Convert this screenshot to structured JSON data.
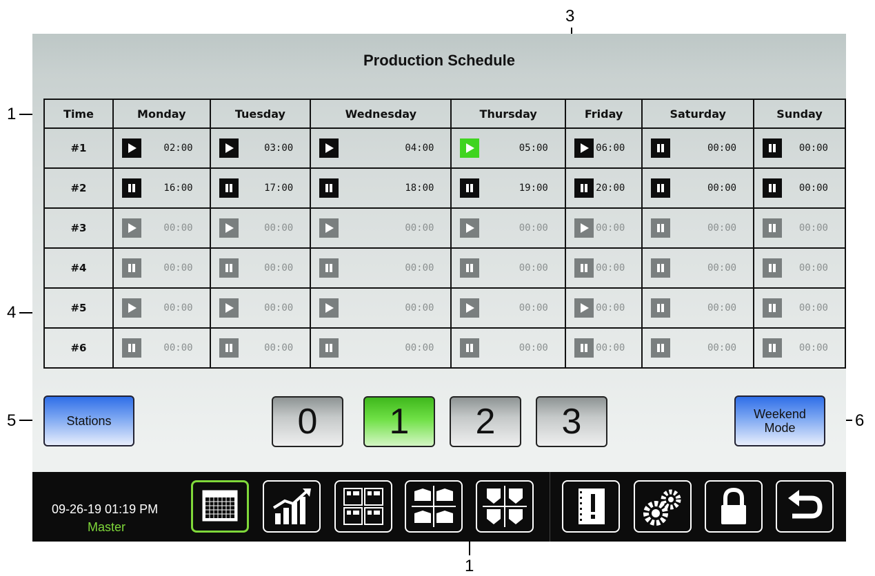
{
  "title": "Production Schedule",
  "table": {
    "time_header": "Time",
    "days": [
      "Monday",
      "Tuesday",
      "Wednesday",
      "Thursday",
      "Friday",
      "Saturday",
      "Sunday"
    ],
    "rows": [
      {
        "label": "#1",
        "cells": [
          {
            "icon": "play",
            "state": "normal",
            "time": "02:00"
          },
          {
            "icon": "play",
            "state": "normal",
            "time": "03:00"
          },
          {
            "icon": "play",
            "state": "normal",
            "time": "04:00"
          },
          {
            "icon": "play",
            "state": "active",
            "time": "05:00"
          },
          {
            "icon": "play",
            "state": "normal",
            "time": "06:00"
          },
          {
            "icon": "pause",
            "state": "normal",
            "time": "00:00"
          },
          {
            "icon": "pause",
            "state": "normal",
            "time": "00:00"
          }
        ]
      },
      {
        "label": "#2",
        "cells": [
          {
            "icon": "pause",
            "state": "normal",
            "time": "16:00"
          },
          {
            "icon": "pause",
            "state": "normal",
            "time": "17:00"
          },
          {
            "icon": "pause",
            "state": "normal",
            "time": "18:00"
          },
          {
            "icon": "pause",
            "state": "normal",
            "time": "19:00"
          },
          {
            "icon": "pause",
            "state": "normal",
            "time": "20:00"
          },
          {
            "icon": "pause",
            "state": "normal",
            "time": "00:00"
          },
          {
            "icon": "pause",
            "state": "normal",
            "time": "00:00"
          }
        ]
      },
      {
        "label": "#3",
        "cells": [
          {
            "icon": "play",
            "state": "inactive",
            "time": "00:00"
          },
          {
            "icon": "play",
            "state": "inactive",
            "time": "00:00"
          },
          {
            "icon": "play",
            "state": "inactive",
            "time": "00:00"
          },
          {
            "icon": "play",
            "state": "inactive",
            "time": "00:00"
          },
          {
            "icon": "play",
            "state": "inactive",
            "time": "00:00"
          },
          {
            "icon": "pause",
            "state": "inactive",
            "time": "00:00"
          },
          {
            "icon": "pause",
            "state": "inactive",
            "time": "00:00"
          }
        ]
      },
      {
        "label": "#4",
        "cells": [
          {
            "icon": "pause",
            "state": "inactive",
            "time": "00:00"
          },
          {
            "icon": "pause",
            "state": "inactive",
            "time": "00:00"
          },
          {
            "icon": "pause",
            "state": "inactive",
            "time": "00:00"
          },
          {
            "icon": "pause",
            "state": "inactive",
            "time": "00:00"
          },
          {
            "icon": "pause",
            "state": "inactive",
            "time": "00:00"
          },
          {
            "icon": "pause",
            "state": "inactive",
            "time": "00:00"
          },
          {
            "icon": "pause",
            "state": "inactive",
            "time": "00:00"
          }
        ]
      },
      {
        "label": "#5",
        "cells": [
          {
            "icon": "play",
            "state": "inactive",
            "time": "00:00"
          },
          {
            "icon": "play",
            "state": "inactive",
            "time": "00:00"
          },
          {
            "icon": "play",
            "state": "inactive",
            "time": "00:00"
          },
          {
            "icon": "play",
            "state": "inactive",
            "time": "00:00"
          },
          {
            "icon": "play",
            "state": "inactive",
            "time": "00:00"
          },
          {
            "icon": "pause",
            "state": "inactive",
            "time": "00:00"
          },
          {
            "icon": "pause",
            "state": "inactive",
            "time": "00:00"
          }
        ]
      },
      {
        "label": "#6",
        "cells": [
          {
            "icon": "pause",
            "state": "inactive",
            "time": "00:00"
          },
          {
            "icon": "pause",
            "state": "inactive",
            "time": "00:00"
          },
          {
            "icon": "pause",
            "state": "inactive",
            "time": "00:00"
          },
          {
            "icon": "pause",
            "state": "inactive",
            "time": "00:00"
          },
          {
            "icon": "pause",
            "state": "inactive",
            "time": "00:00"
          },
          {
            "icon": "pause",
            "state": "inactive",
            "time": "00:00"
          },
          {
            "icon": "pause",
            "state": "inactive",
            "time": "00:00"
          }
        ]
      }
    ]
  },
  "stations_label": "Stations",
  "weekend_mode_label": "Weekend\nMode",
  "pages": [
    "0",
    "1",
    "2",
    "3"
  ],
  "selected_page": "1",
  "footer": {
    "datetime": "09-26-19 01:19 PM",
    "mode": "Master"
  },
  "nav_icons": [
    "calendar-icon",
    "chart-icon",
    "grid-icon",
    "stations-icon",
    "tanks-icon",
    "alarm-book-icon",
    "gears-icon",
    "lock-icon",
    "back-icon"
  ],
  "callouts": [
    "1",
    "3",
    "4",
    "5",
    "6",
    "1"
  ],
  "colors": {
    "active": "#3fd41f",
    "selected_nav": "#7fd83a",
    "blue_button": "#2f6ee8"
  }
}
